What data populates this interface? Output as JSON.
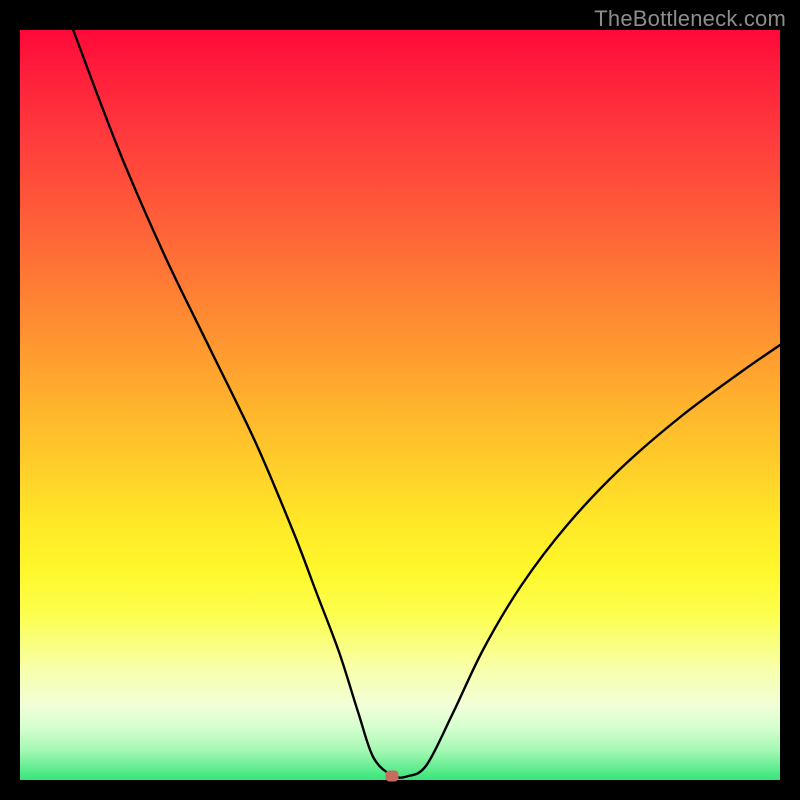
{
  "watermark": "TheBottleneck.com",
  "colors": {
    "gradient_top": "#ff0a3a",
    "gradient_bottom": "#36e579",
    "curve_stroke": "#000000",
    "frame": "#000000",
    "marker": "#c76a60"
  },
  "chart_data": {
    "type": "line",
    "title": "",
    "xlabel": "",
    "ylabel": "",
    "xlim": [
      0,
      100
    ],
    "ylim": [
      0,
      100
    ],
    "series": [
      {
        "name": "bottleneck-curve",
        "x": [
          7,
          13,
          19,
          25,
          31,
          36,
          39,
          42,
          44.5,
          46.5,
          49,
          51,
          53.5,
          57,
          61,
          66,
          72,
          79,
          87,
          95,
          100
        ],
        "y": [
          100,
          84,
          70,
          57.5,
          45,
          33,
          25,
          17,
          9,
          3,
          0.6,
          0.5,
          2,
          9,
          17.5,
          26,
          34,
          41.5,
          48.5,
          54.5,
          58
        ]
      }
    ],
    "annotations": [
      {
        "name": "minimum-marker",
        "x": 49,
        "y": 0.5
      }
    ]
  }
}
